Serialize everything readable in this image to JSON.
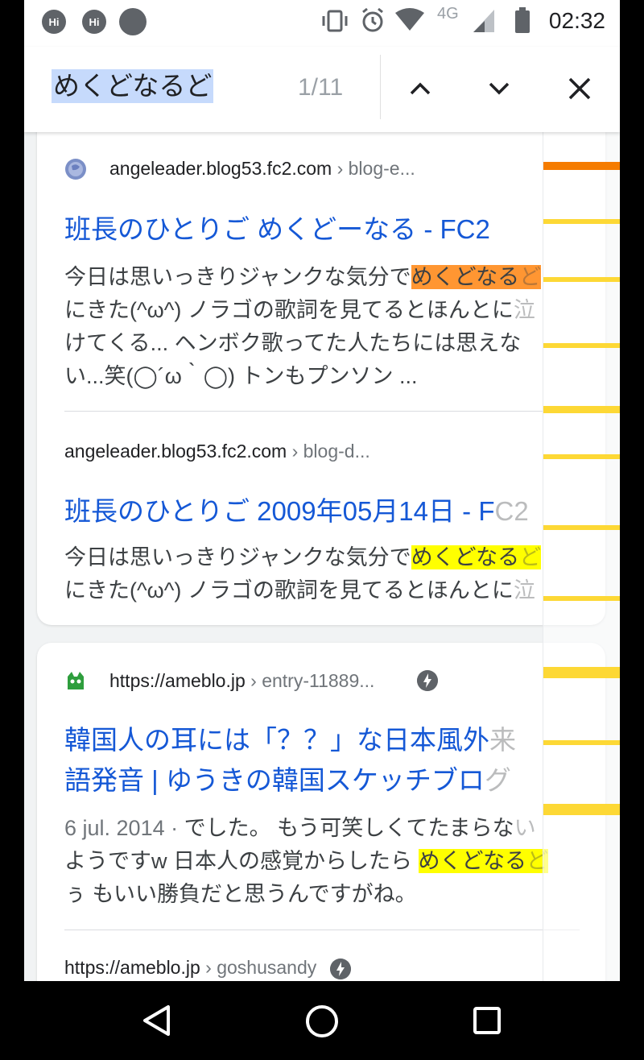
{
  "status_bar": {
    "notif1": "Hi",
    "notif2": "Hi",
    "network": "4G",
    "time": "02:32"
  },
  "find_bar": {
    "query": "めくどなるど",
    "count": "1/11",
    "prev_icon": "chevron-up-icon",
    "next_icon": "chevron-down-icon",
    "close_icon": "close-icon"
  },
  "results": [
    {
      "domain": "angeleader.blog53.fc2.com",
      "path": " › blog-e...",
      "title": "班長のひとりご めくどーなる - FC2",
      "snippet": {
        "pre": "今日は思いっきりジャンクな気分で",
        "hl": "めくどなる",
        "hl_fade": "ど",
        "line2": "にきた(^ω^) ノラゴの歌詞を見てるとほんとに",
        "line2_fade": "泣",
        "line3": "けてくる... ヘンボク歌ってた人たちには思えな",
        "line4": "い...笑(◯´ω｀◯) トンもプンソン ..."
      }
    },
    {
      "domain": "angeleader.blog53.fc2.com",
      "path": " › blog-d...",
      "title": "班長のひとりご 2009年05月14日 - F",
      "title_fade": "C2",
      "snippet": {
        "pre": "今日は思いっきりジャンクな気分で",
        "hl": "めくどなる",
        "hl_fade": "ど",
        "line2": "にきた(^ω^) ノラゴの歌詞を見てるとほんとに",
        "line2_fade": "泣"
      }
    },
    {
      "domain": "https://ameblo.jp",
      "path": " › entry-11889...",
      "title_line1": "韓国人の耳には「？？」な日本風外",
      "title_line1_fade": "来",
      "title_line2": "語発音 | ゆうきの韓国スケッチブロ",
      "title_line2_fade": "グ",
      "snippet": {
        "date": "6 jul. 2014 · ",
        "pre": "でした。 もう可笑しくてたまらな",
        "pre_fade": "い",
        "line2": "ようですw 日本人の感覚からしたら ",
        "hl": "めくどなる",
        "hl_fade": "ど",
        "line3": "ぅ もいい勝負だと思うんですがね。"
      }
    },
    {
      "domain": "https://ameblo.jp",
      "path": " › goshusandy"
    }
  ],
  "nav": {
    "back_icon": "back-triangle-icon",
    "home_icon": "home-circle-icon",
    "recents_icon": "recents-square-icon"
  },
  "colors": {
    "link": "#1558d6",
    "highlight": "#ffff00",
    "scroll_tick": "#fdd835",
    "scroll_tick_current": "#f57c00"
  }
}
